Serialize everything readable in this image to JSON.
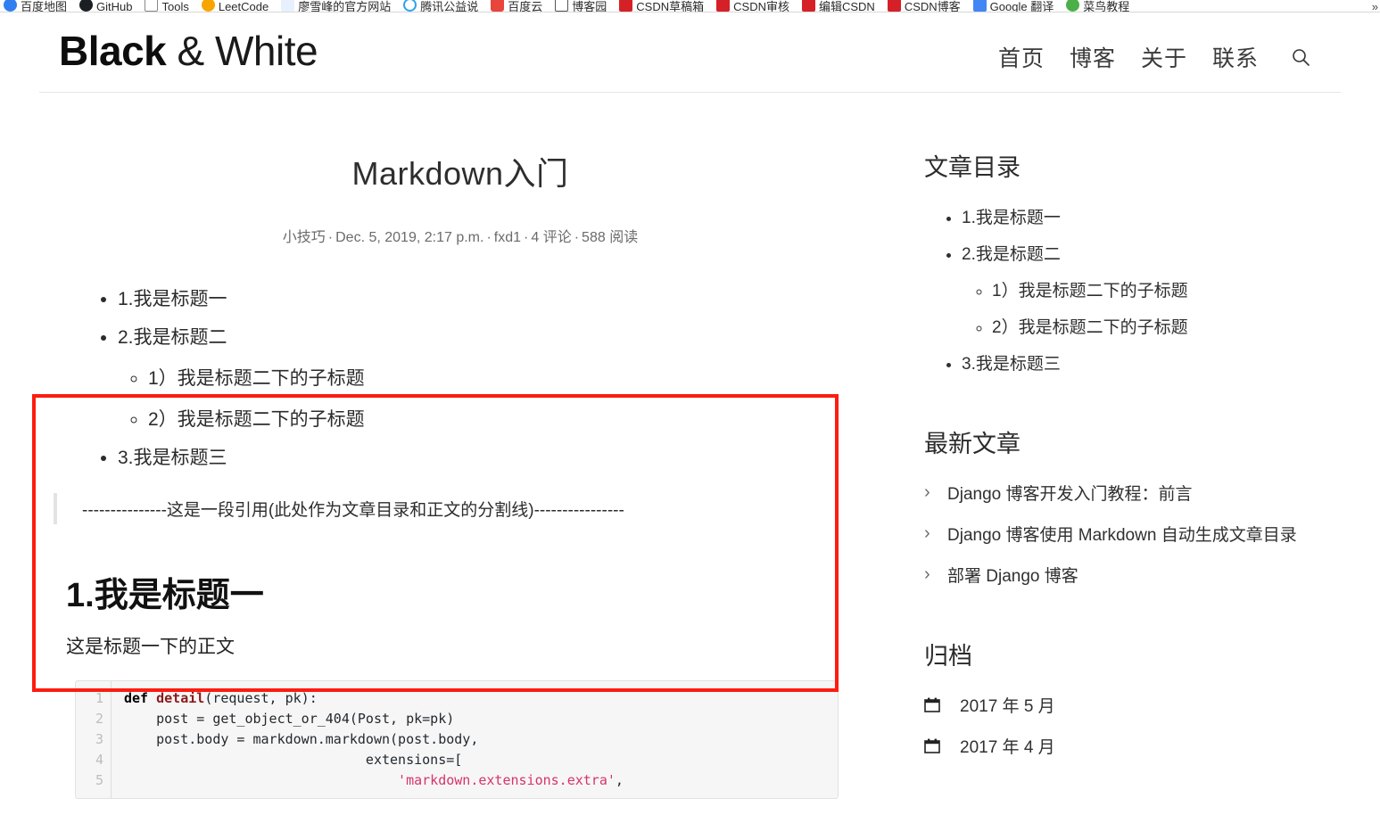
{
  "browser": {
    "bookmarks": [
      {
        "label": "百度地图",
        "icon": "baidu-map-icon",
        "cls": "ico-baidu"
      },
      {
        "label": "GitHub",
        "icon": "github-icon",
        "cls": "ico-github"
      },
      {
        "label": "Tools",
        "icon": "tools-icon",
        "cls": "ico-tools"
      },
      {
        "label": "LeetCode",
        "icon": "leetcode-icon",
        "cls": "ico-leet"
      },
      {
        "label": "廖雪峰的官方网站",
        "icon": "liaoxuefeng-icon",
        "cls": "ico-liao"
      },
      {
        "label": "腾讯公益说",
        "icon": "tencent-icon",
        "cls": "ico-tencent"
      },
      {
        "label": "百度云",
        "icon": "baidu-yun-icon",
        "cls": "ico-baiduy"
      },
      {
        "label": "博客园",
        "icon": "cnblogs-icon",
        "cls": "ico-boke"
      },
      {
        "label": "CSDN草稿箱",
        "icon": "csdn-icon",
        "cls": "ico-csdn"
      },
      {
        "label": "CSDN审核",
        "icon": "csdn-icon",
        "cls": "ico-csdn"
      },
      {
        "label": "编辑CSDN",
        "icon": "csdn-icon",
        "cls": "ico-csdn"
      },
      {
        "label": "CSDN博客",
        "icon": "csdn-icon",
        "cls": "ico-csdn"
      },
      {
        "label": "Google 翻译",
        "icon": "google-translate-icon",
        "cls": "ico-google"
      },
      {
        "label": "菜鸟教程",
        "icon": "runoob-icon",
        "cls": "ico-runoob"
      }
    ],
    "overflow_label": "»"
  },
  "header": {
    "brand_strong": "Black",
    "brand_light": " & White",
    "nav": [
      {
        "label": "首页"
      },
      {
        "label": "博客"
      },
      {
        "label": "关于"
      },
      {
        "label": "联系"
      }
    ],
    "search_icon": "search-icon"
  },
  "article": {
    "title": "Markdown入门",
    "meta": {
      "category": "小技巧",
      "date": "Dec. 5, 2019, 2:17 p.m.",
      "author": "fxd1",
      "comments": "4 评论",
      "reads": "588 阅读",
      "separator": "·"
    },
    "toc": [
      {
        "label": "1.我是标题一",
        "children": []
      },
      {
        "label": "2.我是标题二",
        "children": [
          {
            "label": "1）我是标题二下的子标题"
          },
          {
            "label": "2）我是标题二下的子标题"
          }
        ]
      },
      {
        "label": "3.我是标题三",
        "children": []
      }
    ],
    "blockquote": "---------------这是一段引用(此处作为文章目录和正文的分割线)----------------",
    "section_heading": "1.我是标题一",
    "section_paragraph": "这是标题一下的正文",
    "code": {
      "line_numbers": [
        "1",
        "2",
        "3",
        "4",
        "5"
      ],
      "lines": [
        {
          "parts": [
            {
              "t": "def ",
              "c": "tok-kw"
            },
            {
              "t": "detail",
              "c": "tok-fn"
            },
            {
              "t": "(request, pk):",
              "c": ""
            }
          ]
        },
        {
          "parts": [
            {
              "t": "    post = get_object_or_404(Post, pk=pk)",
              "c": ""
            }
          ]
        },
        {
          "parts": [
            {
              "t": "    post.body = markdown.markdown(post.body,",
              "c": ""
            }
          ]
        },
        {
          "parts": [
            {
              "t": "                              extensions=[",
              "c": ""
            }
          ]
        },
        {
          "parts": [
            {
              "t": "                                  ",
              "c": ""
            },
            {
              "t": "'markdown.extensions.extra'",
              "c": "tok-str"
            },
            {
              "t": ",",
              "c": ""
            }
          ]
        }
      ]
    }
  },
  "sidebar": {
    "toc_heading": "文章目录",
    "toc": [
      {
        "label": "1.我是标题一",
        "children": []
      },
      {
        "label": "2.我是标题二",
        "children": [
          {
            "label": "1）我是标题二下的子标题"
          },
          {
            "label": "2）我是标题二下的子标题"
          }
        ]
      },
      {
        "label": "3.我是标题三",
        "children": []
      }
    ],
    "recent_heading": "最新文章",
    "recent": [
      {
        "label": "Django 博客开发入门教程：前言",
        "icon": "chevron-right-icon"
      },
      {
        "label": "Django 博客使用 Markdown 自动生成文章目录",
        "icon": "chevron-right-icon"
      },
      {
        "label": "部署 Django 博客",
        "icon": "chevron-right-icon"
      }
    ],
    "archive_heading": "归档",
    "archive": [
      {
        "label": "2017 年 5 月",
        "icon": "calendar-icon"
      },
      {
        "label": "2017 年 4 月",
        "icon": "calendar-icon"
      }
    ]
  },
  "annotation": {
    "color": "#fc1c10",
    "name": "red-highlight-box"
  }
}
